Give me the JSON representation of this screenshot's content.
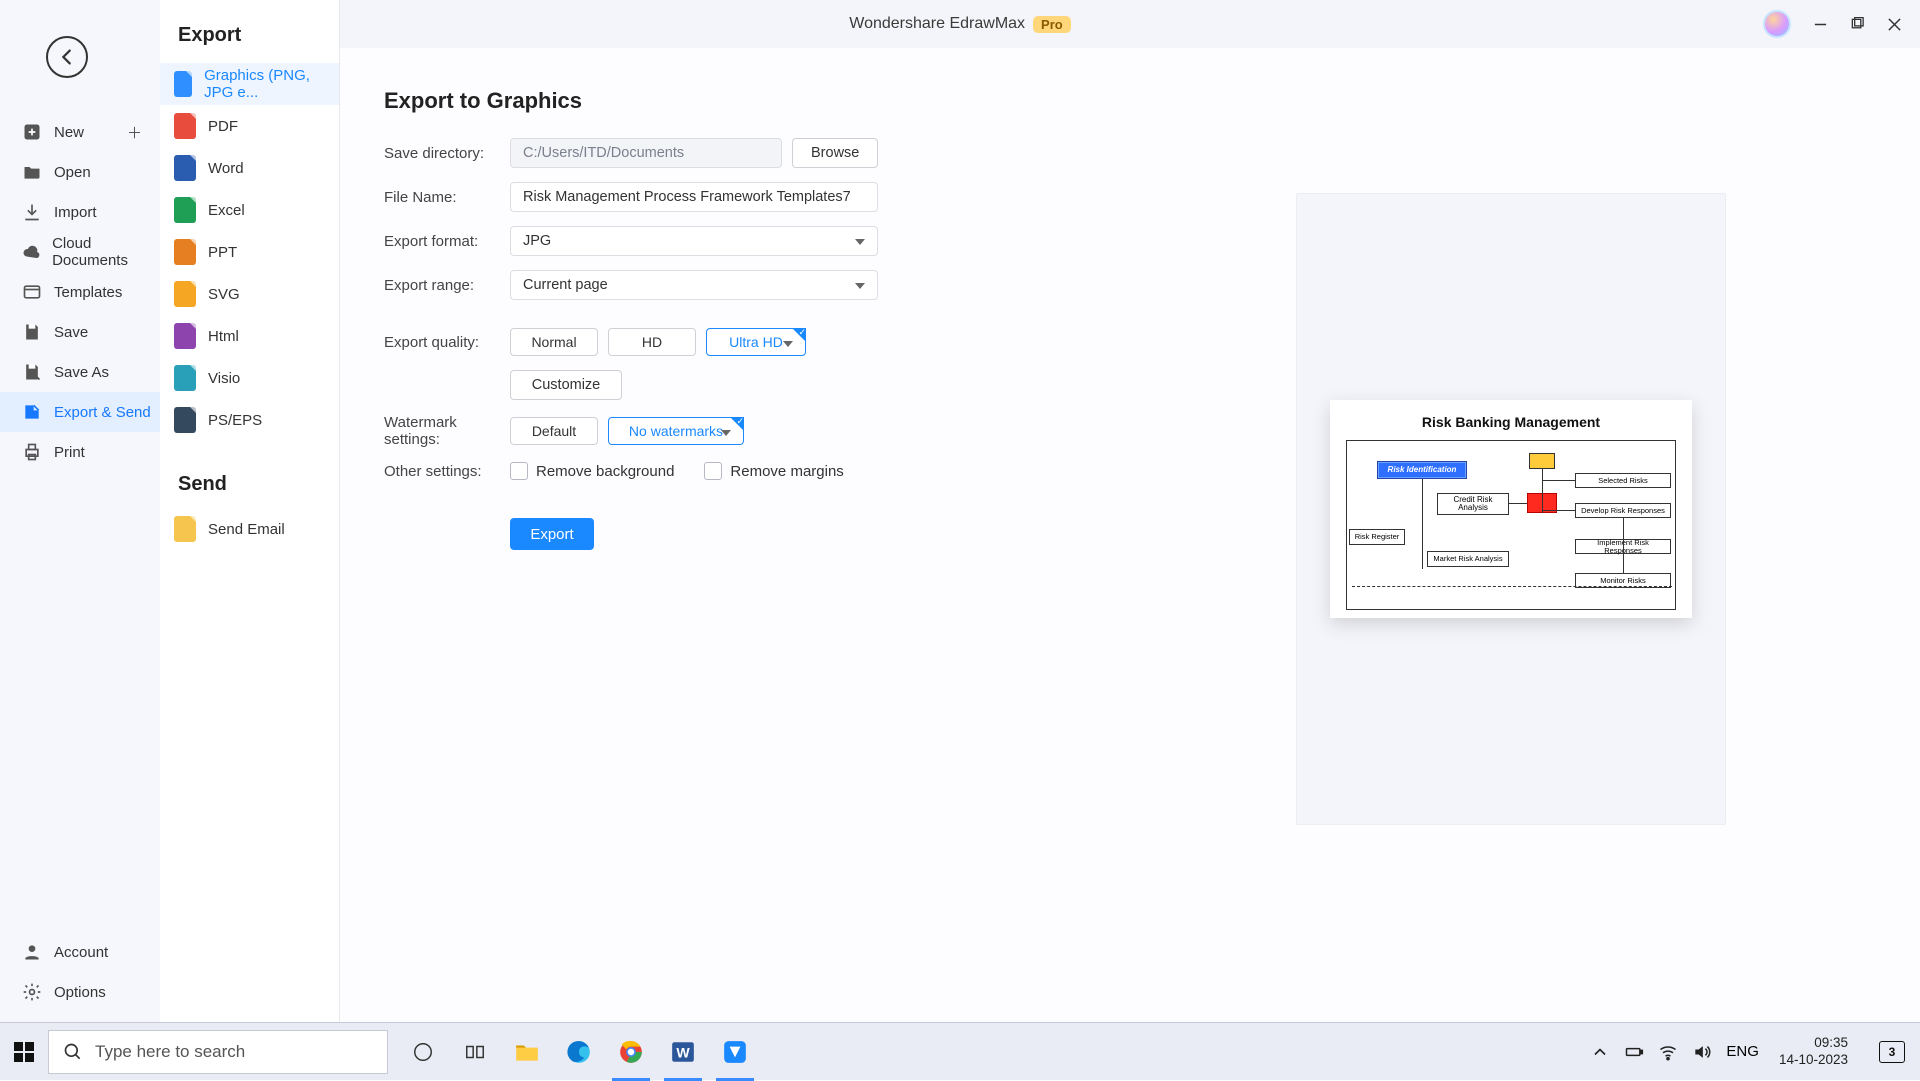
{
  "app": {
    "title": "Wondershare EdrawMax",
    "badge": "Pro"
  },
  "left": {
    "items": [
      {
        "label": "New"
      },
      {
        "label": "Open"
      },
      {
        "label": "Import"
      },
      {
        "label": "Cloud Documents"
      },
      {
        "label": "Templates"
      },
      {
        "label": "Save"
      },
      {
        "label": "Save As"
      },
      {
        "label": "Export & Send"
      },
      {
        "label": "Print"
      }
    ],
    "bottom": [
      {
        "label": "Account"
      },
      {
        "label": "Options"
      }
    ]
  },
  "col2": {
    "export_heading": "Export",
    "send_heading": "Send",
    "formats": [
      {
        "label": "Graphics (PNG, JPG e..."
      },
      {
        "label": "PDF"
      },
      {
        "label": "Word"
      },
      {
        "label": "Excel"
      },
      {
        "label": "PPT"
      },
      {
        "label": "SVG"
      },
      {
        "label": "Html"
      },
      {
        "label": "Visio"
      },
      {
        "label": "PS/EPS"
      }
    ],
    "send_items": [
      {
        "label": "Send Email"
      }
    ]
  },
  "main": {
    "heading": "Export to Graphics",
    "save_dir_label": "Save directory:",
    "save_dir_value": "C:/Users/ITD/Documents",
    "browse": "Browse",
    "file_name_label": "File Name:",
    "file_name_value": "Risk Management Process Framework Templates7",
    "format_label": "Export format:",
    "format_value": "JPG",
    "range_label": "Export range:",
    "range_value": "Current page",
    "quality_label": "Export quality:",
    "quality": {
      "normal": "Normal",
      "hd": "HD",
      "uhd": "Ultra HD"
    },
    "customize": "Customize",
    "watermark_label": "Watermark settings:",
    "watermark": {
      "def": "Default",
      "none": "No watermarks"
    },
    "other_label": "Other settings:",
    "remove_bg": "Remove background",
    "remove_margins": "Remove margins",
    "export_btn": "Export"
  },
  "preview": {
    "title": "Risk Banking Management",
    "boxes": {
      "identification": "Risk Identification",
      "credit": "Credit Risk Analysis",
      "market": "Market Risk Analysis",
      "register": "Risk Register",
      "selected": "Selected Risks",
      "develop": "Develop Risk Responses",
      "implement": "Implement Risk Responses",
      "monitor": "Monitor Risks"
    }
  },
  "taskbar": {
    "search_placeholder": "Type here to search",
    "lang": "ENG",
    "time": "09:35",
    "date": "14-10-2023",
    "notif_count": "3"
  }
}
